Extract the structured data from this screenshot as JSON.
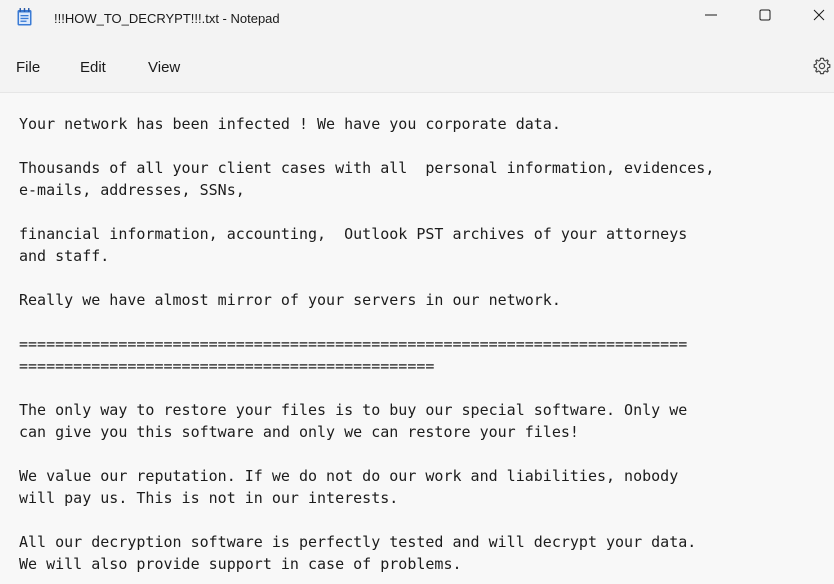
{
  "window": {
    "title": "!!!HOW_TO_DECRYPT!!!.txt - Notepad",
    "app_icon": "notepad-icon",
    "controls": {
      "minimize_icon": "minimize-icon",
      "maximize_icon": "maximize-icon",
      "close_icon": "close-icon"
    }
  },
  "menu": {
    "items": [
      {
        "label": "File"
      },
      {
        "label": "Edit"
      },
      {
        "label": "View"
      }
    ],
    "settings_icon": "gear-icon"
  },
  "editor": {
    "lines": [
      "Your network has been infected ! We have you corporate data.",
      "",
      "Thousands of all your client cases with all  personal information, evidences,",
      "e-mails, addresses, SSNs,",
      "",
      "financial information, accounting,  Outlook PST archives of your attorneys",
      "and staff.",
      "",
      "Really we have almost mirror of your servers in our network.",
      "",
      "==========================================================================",
      "==============================================",
      "",
      "The only way to restore your files is to buy our special software. Only we",
      "can give you this software and only we can restore your files!",
      "",
      "We value our reputation. If we do not do our work and liabilities, nobody",
      "will pay us. This is not in our interests.",
      "",
      "All our decryption software is perfectly tested and will decrypt your data.",
      "We will also provide support in case of problems."
    ]
  },
  "colors": {
    "window_bg": "#f3f3f3",
    "editor_bg": "#f8f8f8",
    "text": "#1c1c1c",
    "icon_blue": "#3a7bd5"
  }
}
